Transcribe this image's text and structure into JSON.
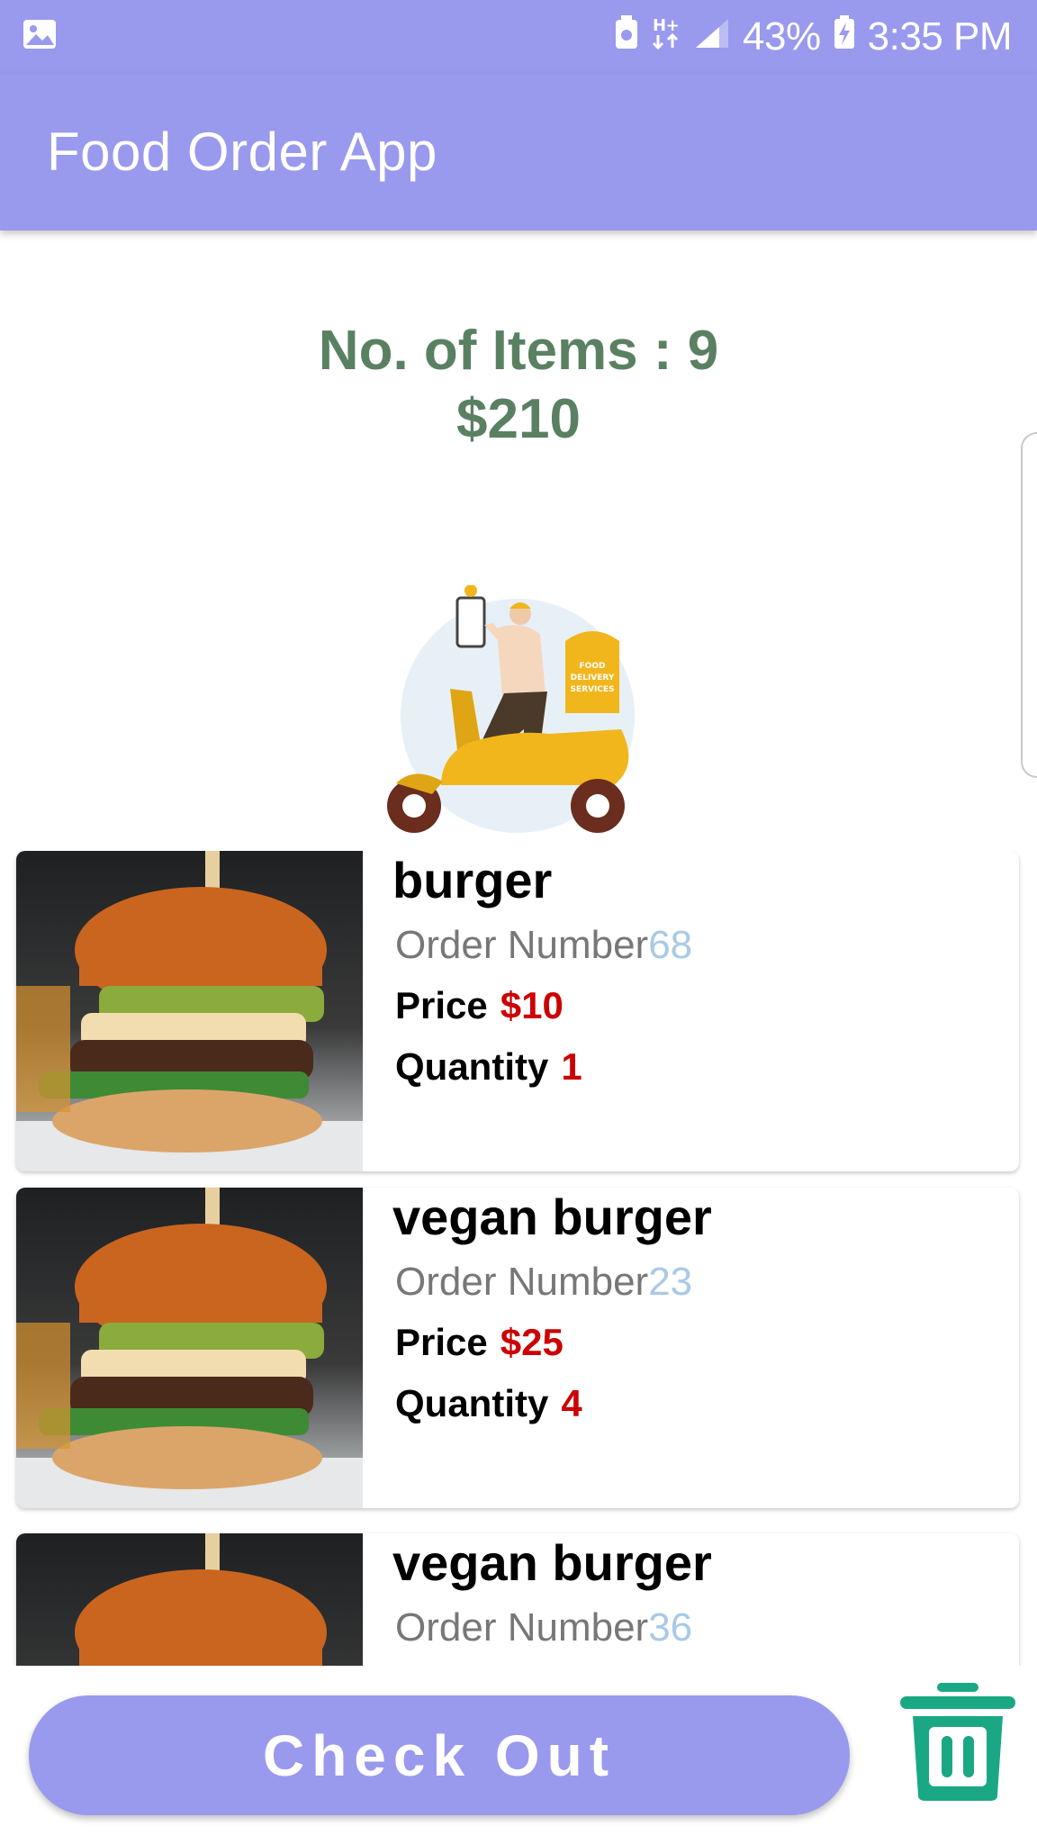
{
  "status_bar": {
    "battery": "43%",
    "time": "3:35 PM",
    "icons": [
      "gallery-icon",
      "media-icon",
      "h-plus-data-icon",
      "signal-icon",
      "battery-charging-icon"
    ]
  },
  "app_bar": {
    "title": "Food Order App"
  },
  "summary": {
    "items_text": "No. of Items : 9",
    "total": "$210"
  },
  "illustration": {
    "sign_line1": "FOOD",
    "sign_line2": "DELIVERY",
    "sign_line3": "SERVICES"
  },
  "labels": {
    "order_number": "Order Number",
    "price": "Price",
    "quantity": "Quantity"
  },
  "orders": [
    {
      "name": "burger",
      "order_number": "68",
      "price": "$10",
      "quantity": "1"
    },
    {
      "name": "vegan burger",
      "order_number": "23",
      "price": "$25",
      "quantity": "4"
    },
    {
      "name": "vegan burger",
      "order_number": "36"
    }
  ],
  "footer": {
    "checkout_label": "Check Out"
  },
  "colors": {
    "primary": "#9999ee",
    "summary_green": "#5a8062",
    "price_red": "#cc0000",
    "order_number_blue": "#a9c9e6",
    "trash_green": "#1aa884"
  }
}
